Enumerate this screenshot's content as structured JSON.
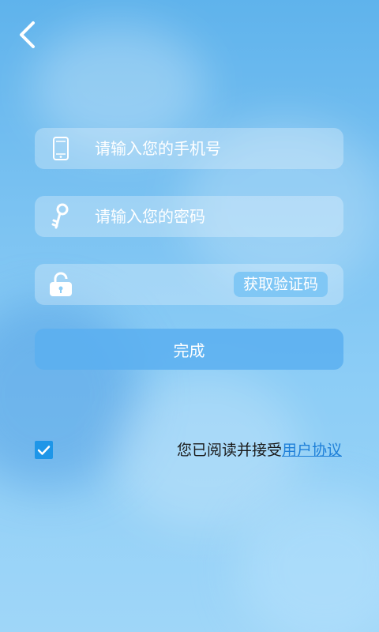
{
  "form": {
    "phone_placeholder": "请输入您的手机号",
    "password_placeholder": "请输入您的密码",
    "code_placeholder": "",
    "get_code_label": "获取验证码",
    "submit_label": "完成"
  },
  "agreement": {
    "checked": true,
    "text": "您已阅读并接受",
    "link_label": "用户协议"
  },
  "colors": {
    "accent": "#1e96e8",
    "link": "#1e7fd8"
  },
  "icons": {
    "back": "back-arrow-icon",
    "phone": "phone-icon",
    "key": "key-icon",
    "lock": "lock-icon",
    "check": "checkmark-icon"
  }
}
